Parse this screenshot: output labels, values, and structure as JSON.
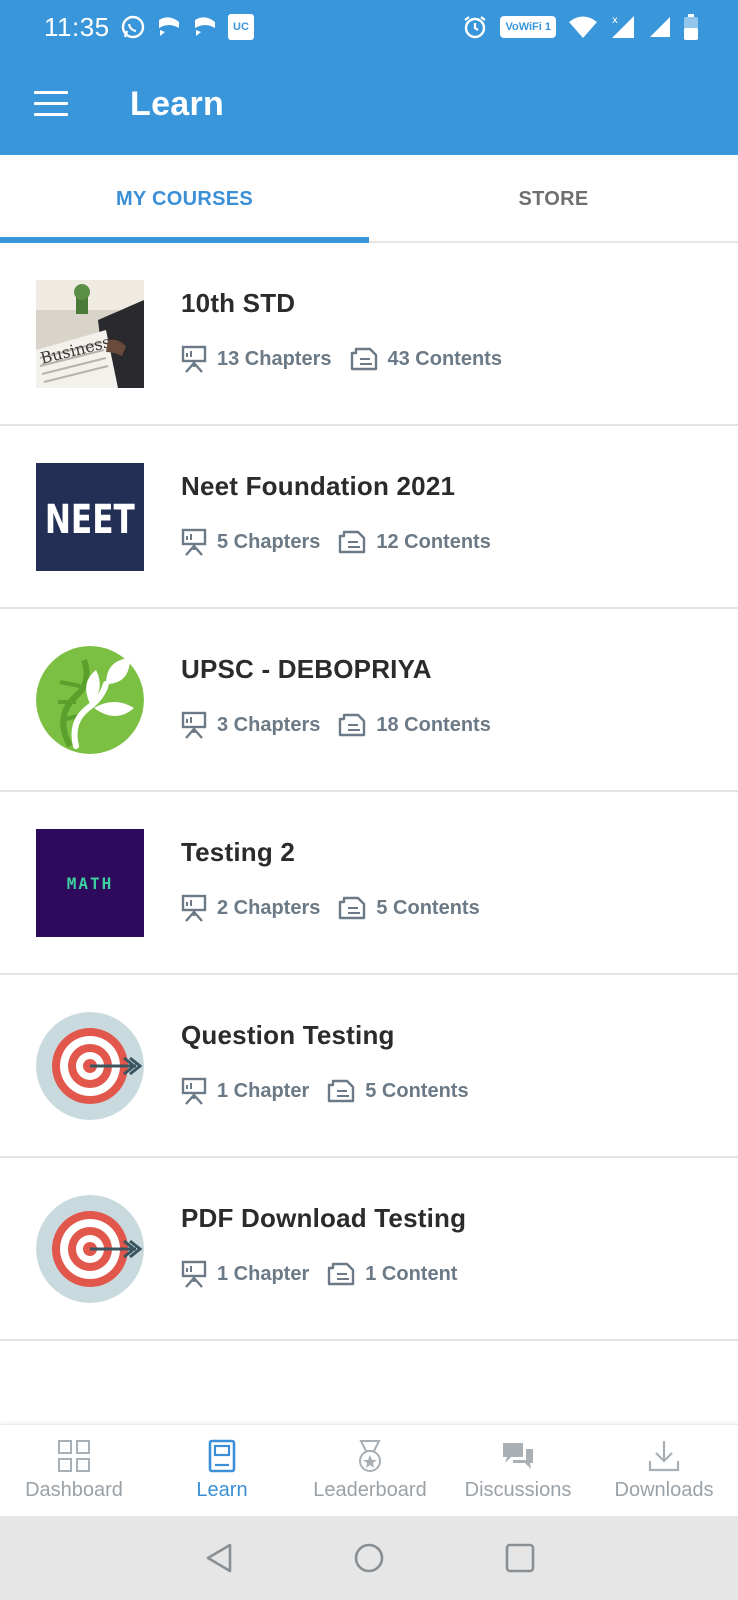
{
  "status_bar": {
    "time": "11:35",
    "uc_label": "UC",
    "wifi_label": "VoWiFi 1",
    "network_x": "x"
  },
  "app_bar": {
    "title": "Learn"
  },
  "tabs": [
    {
      "label": "MY COURSES",
      "active": true
    },
    {
      "label": "STORE",
      "active": false
    }
  ],
  "courses": [
    {
      "title": "10th STD",
      "chapters": "13 Chapters",
      "contents": "43 Contents",
      "thumb": "business-newspaper-photo",
      "thumb_text": "Business"
    },
    {
      "title": "Neet Foundation 2021",
      "chapters": "5 Chapters",
      "contents": "12 Contents",
      "thumb": "neet-logo",
      "thumb_text": "NEET"
    },
    {
      "title": "UPSC - DEBOPRIYA",
      "chapters": "3 Chapters",
      "contents": "18 Contents",
      "thumb": "leaf-dna-logo"
    },
    {
      "title": "Testing 2",
      "chapters": "2 Chapters",
      "contents": "5 Contents",
      "thumb": "math-logo",
      "thumb_text": "MATH"
    },
    {
      "title": "Question Testing",
      "chapters": "1 Chapter",
      "contents": "5 Contents",
      "thumb": "target-icon"
    },
    {
      "title": "PDF Download Testing",
      "chapters": "1 Chapter",
      "contents": "1 Content",
      "thumb": "target-icon"
    }
  ],
  "bottom_nav": [
    {
      "label": "Dashboard",
      "icon": "dashboard-icon",
      "active": false
    },
    {
      "label": "Learn",
      "icon": "book-icon",
      "active": true
    },
    {
      "label": "Leaderboard",
      "icon": "medal-icon",
      "active": false
    },
    {
      "label": "Discussions",
      "icon": "chat-icon",
      "active": false
    },
    {
      "label": "Downloads",
      "icon": "download-icon",
      "active": false
    }
  ],
  "colors": {
    "primary": "#3a96db",
    "active_tab_text": "#3a8fd6",
    "meta_text": "#6b7a86",
    "title_text": "#2b2b2b"
  }
}
